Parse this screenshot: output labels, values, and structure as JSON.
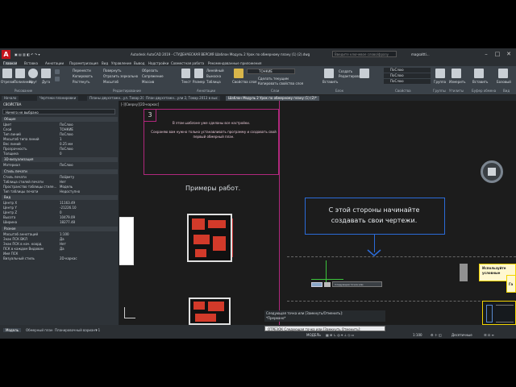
{
  "window": {
    "title": "Autodesk AutoCAD 2019 - СТУДЕНЧЕСКАЯ ВЕРСИЯ   Шаблон Модуль 2 Урок по обмерному плану (1) (2).dwg",
    "search_placeholder": "Введите ключевое слово/фразу",
    "user": "magsaltti..."
  },
  "ribbon": {
    "tabs": [
      "Главная",
      "Вставка",
      "Аннотации",
      "Параметризация",
      "Вид",
      "Управление",
      "Вывод",
      "Надстройки",
      "Совместная работа",
      "Рекомендованные приложения"
    ],
    "active_tab": "Главная",
    "groups": [
      "Рисование",
      "Редактирование",
      "Аннотации",
      "Слои",
      "Блок",
      "Свойства",
      "Группы",
      "Утилиты",
      "Буфер обмена",
      "Вид"
    ],
    "draw_buttons": [
      "Отрезок",
      "Полилиния",
      "Круг",
      "Дуга"
    ],
    "modify_buttons": [
      "Перенести",
      "Повернуть",
      "Обрезать",
      "Копировать",
      "Отразить зеркально",
      "Сопряжение",
      "Растянуть",
      "Масштаб",
      "Массив"
    ],
    "annot_buttons": [
      "Текст",
      "Размер",
      "Линейный",
      "Выноска",
      "Таблица"
    ],
    "layer_buttons": [
      "Свойства слоя",
      "Сделать текущим",
      "Копировать свойства слоя"
    ],
    "block_buttons": [
      "Вставить",
      "Создать",
      "Редактировать"
    ],
    "props_values": [
      "ПоСлою",
      "ПоСлою",
      "ПоСлою"
    ],
    "layer_value": "ТОНКИЕ",
    "other_buttons": [
      "Группа",
      "Измерить",
      "Вставить",
      "Базовый"
    ]
  },
  "doc_tabs": [
    "Начало",
    "Чертежи планировки",
    "Планы двухэтажн...ул. Товар 2013 в высот",
    "План двухэтажн...ули 2, Товар 2013 в выс",
    "Шаблон Модуль 2 Урок по обмерному плану (1) (2)*"
  ],
  "doc_tab_active": 4,
  "properties": {
    "title": "СВОЙСТВА",
    "selection": "Ничего не выбрано",
    "sections": [
      {
        "name": "Общие",
        "rows": [
          [
            "Цвет",
            "ПоСлою"
          ],
          [
            "Слой",
            "ТОНКИЕ"
          ],
          [
            "Тип линий",
            "ПоСлою"
          ],
          [
            "Масштаб типа линий",
            "1"
          ],
          [
            "Вес линий",
            "0.25 мм"
          ],
          [
            "Прозрачность",
            "ПоСлою"
          ],
          [
            "Толщина",
            "0"
          ]
        ]
      },
      {
        "name": "3D-визуализация",
        "rows": [
          [
            "Материал",
            "ПоСлою"
          ]
        ]
      },
      {
        "name": "Стиль печати",
        "rows": [
          [
            "Стиль печати",
            "ПоЦвету"
          ],
          [
            "Таблица стилей печати",
            "Нет"
          ],
          [
            "Пространство таблицы стиле...",
            "Модель"
          ],
          [
            "Тип таблицы печати",
            "Недоступно"
          ]
        ]
      },
      {
        "name": "Вид",
        "rows": [
          [
            "Центр X",
            "11163.49"
          ],
          [
            "Центр Y",
            "-21226.10"
          ],
          [
            "Центр Z",
            "0"
          ],
          [
            "Высота",
            "10479.09"
          ],
          [
            "Ширина",
            "18277.48"
          ]
        ]
      },
      {
        "name": "Разное",
        "rows": [
          [
            "Масштаб аннотаций",
            "1:100"
          ],
          [
            "Знак ПСК ВКЛ",
            "Да"
          ],
          [
            "Знак ПСК в нач. коорд",
            "Нет"
          ],
          [
            "ПСК в каждом Видовом",
            "Да"
          ],
          [
            "Имя ПСК",
            ""
          ],
          [
            "Визуальный стиль",
            "2D-каркас"
          ]
        ]
      }
    ]
  },
  "canvas": {
    "viewport_label": "[-][Сверху][2D-каркас]",
    "frame_number": "3",
    "note_line1": "В этом шаблоне уже сделаны все настройки.",
    "note_line2": "Сохраняю вам нужно только устанавливать программу и создавать свой первый обмерный план.",
    "examples_title": "Примеры работ.",
    "callout": "С этой стороны начинайте создавать свои чертежи.",
    "right_label_1": "Используйте условные",
    "right_label_2": "Га",
    "cursor_tooltip": "Следующая точка или",
    "command_history_1": "Следующая точка или [Замкнуть/Отменить]:",
    "command_history_2": "*Прервано*",
    "command_line": "ОТРЕЗОК Следующая точка или [Замкнуть Отменить]:"
  },
  "status": {
    "layout_tabs": [
      "Модель",
      "Обмерный план",
      "Планировочный вариант 1"
    ],
    "active_layout": "Модель",
    "mode": "МОДЕЛЬ",
    "scale": "1:100",
    "units": "Десятичные"
  },
  "colors": {
    "frame_magenta": "#b0287c",
    "callout_blue": "#2b6bd8",
    "highlight_yellow": "#f2d400",
    "crosshair_green": "#3cc43c"
  }
}
